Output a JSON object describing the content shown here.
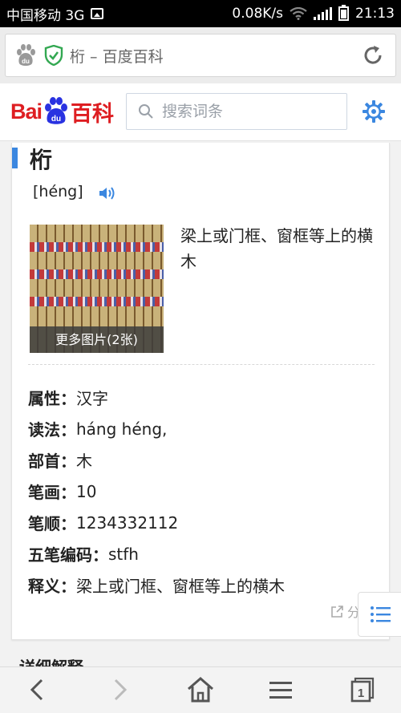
{
  "status_bar": {
    "carrier": "中国移动 3G",
    "speed": "0.08K/s",
    "time": "21:13"
  },
  "address_bar": {
    "page_title": "桁 – 百度百科"
  },
  "header": {
    "logo_text_bai": "Bai",
    "logo_text_du": "du",
    "logo_text_baike": "百科",
    "search_placeholder": "搜索词条"
  },
  "entry": {
    "title": "桁",
    "pinyin": "[héng]",
    "image_caption": "更多图片(2张)",
    "summary": "梁上或门框、窗框等上的横木",
    "properties": [
      {
        "key": "属性：",
        "value": "汉字"
      },
      {
        "key": "读法：",
        "value": "háng  héng,"
      },
      {
        "key": "部首：",
        "value": "木"
      },
      {
        "key": "笔画：",
        "value": "10"
      },
      {
        "key": "笔顺：",
        "value": "1234332112"
      },
      {
        "key": "五笔编码：",
        "value": "stfh"
      },
      {
        "key": "释义：",
        "value": "梁上或门框、窗框等上的横木"
      }
    ],
    "share_label": "分享"
  },
  "next_section_peek": "详细解释",
  "colors": {
    "accent_blue": "#3b87e0",
    "baidu_red": "#de1e22",
    "baidu_blue": "#2932e1",
    "secure_green": "#33a852"
  }
}
